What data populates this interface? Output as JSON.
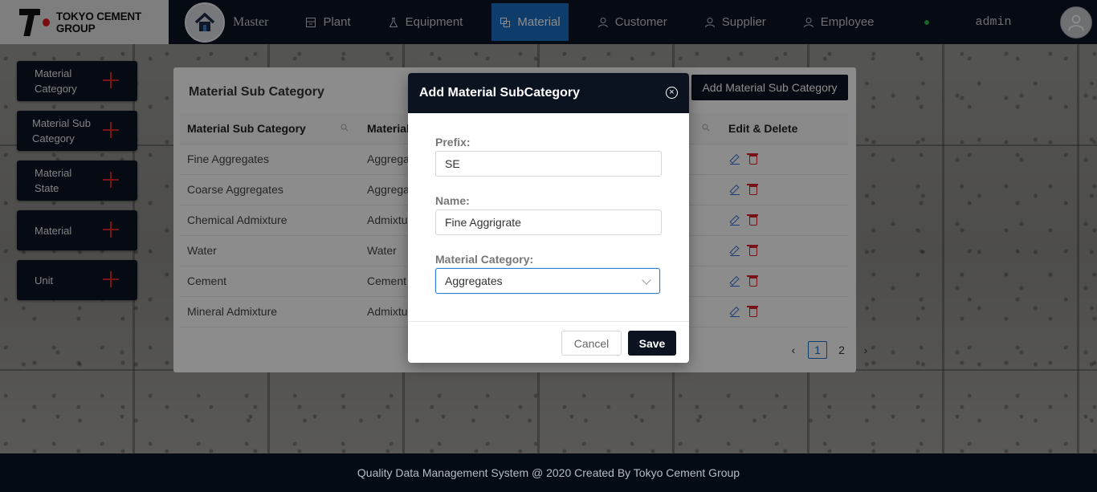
{
  "header": {
    "logo_text": "TOKYO CEMENT GROUP",
    "master_label": "Master",
    "nav": [
      {
        "label": "Plant",
        "icon": "building-icon"
      },
      {
        "label": "Equipment",
        "icon": "flask-icon"
      },
      {
        "label": "Material",
        "icon": "copy-icon",
        "active": true
      },
      {
        "label": "Customer",
        "icon": "user-icon"
      },
      {
        "label": "Supplier",
        "icon": "user-icon"
      },
      {
        "label": "Employee",
        "icon": "user-icon"
      }
    ],
    "user": "admin"
  },
  "sidebar": {
    "items": [
      {
        "label": "Material Category"
      },
      {
        "label": "Material Sub Category"
      },
      {
        "label": "Material State"
      },
      {
        "label": "Material"
      },
      {
        "label": "Unit"
      }
    ]
  },
  "card": {
    "title": "Material Sub Category",
    "add_button": "Add Material Sub Category",
    "columns": [
      "Material Sub Category",
      "Material",
      "Edit & Delete"
    ],
    "rows": [
      {
        "sub": "Fine Aggregates",
        "material": "Aggrega"
      },
      {
        "sub": "Coarse Aggregates",
        "material": "Aggrega"
      },
      {
        "sub": "Chemical Admixture",
        "material": "Admixtu"
      },
      {
        "sub": "Water",
        "material": "Water"
      },
      {
        "sub": "Cement",
        "material": "Cement"
      },
      {
        "sub": "Mineral Admixture",
        "material": "Admixtu"
      }
    ],
    "pagination": {
      "pages": [
        "1",
        "2"
      ],
      "current": "1"
    }
  },
  "modal": {
    "title": "Add Material SubCategory",
    "prefix_label": "Prefix:",
    "prefix_value": "SE",
    "name_label": "Name:",
    "name_value": "Fine Aggrigrate",
    "category_label": "Material Category:",
    "category_value": "Aggregates",
    "cancel": "Cancel",
    "save": "Save"
  },
  "footer": {
    "text": "Quality Data Management System @ 2020 Created By Tokyo Cement Group"
  },
  "colors": {
    "navy": "#0b1321",
    "active_blue": "#1a6fc4",
    "accent_red": "#e0262b"
  }
}
